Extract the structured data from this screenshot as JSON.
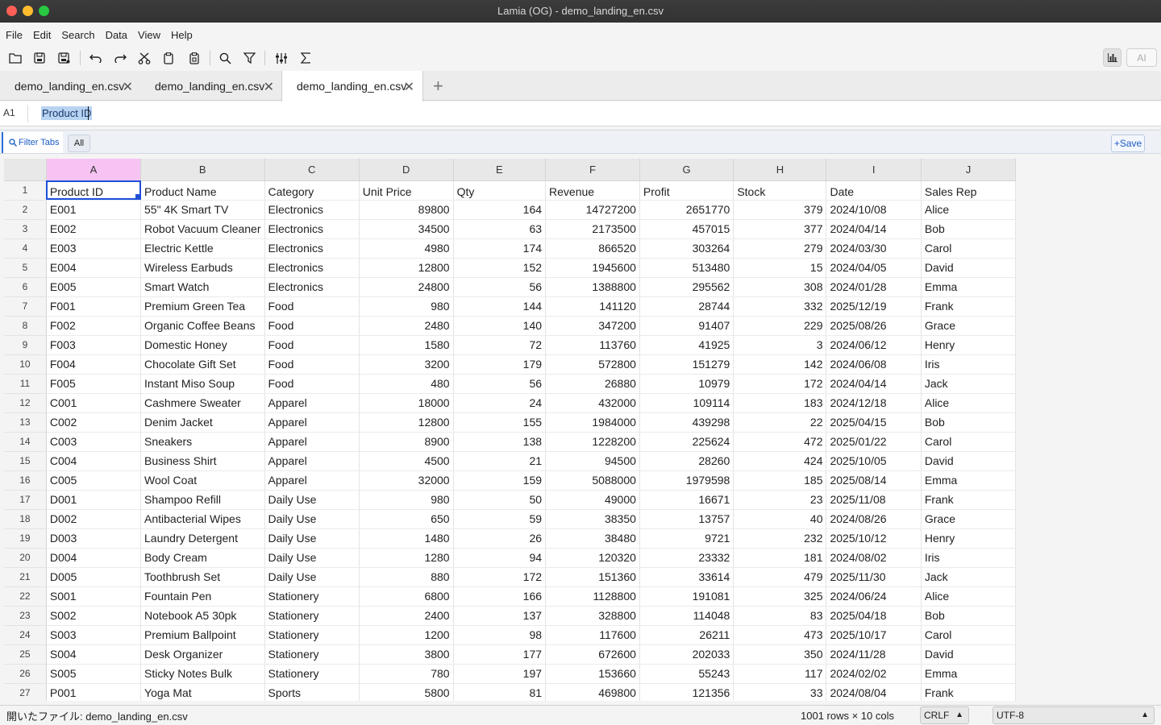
{
  "title": "Lamia (OG) - demo_landing_en.csv",
  "menu": [
    "File",
    "Edit",
    "Search",
    "Data",
    "View",
    "Help"
  ],
  "toolbar": {
    "ai_label": "AI"
  },
  "tabs": [
    {
      "label": "demo_landing_en.csv"
    },
    {
      "label": "demo_landing_en.csv"
    },
    {
      "label": "demo_landing_en.csv"
    }
  ],
  "formula": {
    "cell_ref": "A1",
    "value": "Product ID"
  },
  "filterbar": {
    "filter_label": "Filter Tabs",
    "all_label": "All",
    "save_label": "+Save"
  },
  "grid": {
    "columns": [
      "A",
      "B",
      "C",
      "D",
      "E",
      "F",
      "G",
      "H",
      "I",
      "J"
    ],
    "rows": [
      [
        "Product ID",
        "Product Name",
        "Category",
        "Unit Price",
        "Qty",
        "Revenue",
        "Profit",
        "Stock",
        "Date",
        "Sales Rep"
      ],
      [
        "E001",
        "55\" 4K Smart TV",
        "Electronics",
        "89800",
        "164",
        "14727200",
        "2651770",
        "379",
        "2024/10/08",
        "Alice"
      ],
      [
        "E002",
        "Robot Vacuum Cleaner",
        "Electronics",
        "34500",
        "63",
        "2173500",
        "457015",
        "377",
        "2024/04/14",
        "Bob"
      ],
      [
        "E003",
        "Electric Kettle",
        "Electronics",
        "4980",
        "174",
        "866520",
        "303264",
        "279",
        "2024/03/30",
        "Carol"
      ],
      [
        "E004",
        "Wireless Earbuds",
        "Electronics",
        "12800",
        "152",
        "1945600",
        "513480",
        "15",
        "2024/04/05",
        "David"
      ],
      [
        "E005",
        "Smart Watch",
        "Electronics",
        "24800",
        "56",
        "1388800",
        "295562",
        "308",
        "2024/01/28",
        "Emma"
      ],
      [
        "F001",
        "Premium Green Tea",
        "Food",
        "980",
        "144",
        "141120",
        "28744",
        "332",
        "2025/12/19",
        "Frank"
      ],
      [
        "F002",
        "Organic Coffee Beans",
        "Food",
        "2480",
        "140",
        "347200",
        "91407",
        "229",
        "2025/08/26",
        "Grace"
      ],
      [
        "F003",
        "Domestic Honey",
        "Food",
        "1580",
        "72",
        "113760",
        "41925",
        "3",
        "2024/06/12",
        "Henry"
      ],
      [
        "F004",
        "Chocolate Gift Set",
        "Food",
        "3200",
        "179",
        "572800",
        "151279",
        "142",
        "2024/06/08",
        "Iris"
      ],
      [
        "F005",
        "Instant Miso Soup",
        "Food",
        "480",
        "56",
        "26880",
        "10979",
        "172",
        "2024/04/14",
        "Jack"
      ],
      [
        "C001",
        "Cashmere Sweater",
        "Apparel",
        "18000",
        "24",
        "432000",
        "109114",
        "183",
        "2024/12/18",
        "Alice"
      ],
      [
        "C002",
        "Denim Jacket",
        "Apparel",
        "12800",
        "155",
        "1984000",
        "439298",
        "22",
        "2025/04/15",
        "Bob"
      ],
      [
        "C003",
        "Sneakers",
        "Apparel",
        "8900",
        "138",
        "1228200",
        "225624",
        "472",
        "2025/01/22",
        "Carol"
      ],
      [
        "C004",
        "Business Shirt",
        "Apparel",
        "4500",
        "21",
        "94500",
        "28260",
        "424",
        "2025/10/05",
        "David"
      ],
      [
        "C005",
        "Wool Coat",
        "Apparel",
        "32000",
        "159",
        "5088000",
        "1979598",
        "185",
        "2025/08/14",
        "Emma"
      ],
      [
        "D001",
        "Shampoo Refill",
        "Daily Use",
        "980",
        "50",
        "49000",
        "16671",
        "23",
        "2025/11/08",
        "Frank"
      ],
      [
        "D002",
        "Antibacterial Wipes",
        "Daily Use",
        "650",
        "59",
        "38350",
        "13757",
        "40",
        "2024/08/26",
        "Grace"
      ],
      [
        "D003",
        "Laundry Detergent",
        "Daily Use",
        "1480",
        "26",
        "38480",
        "9721",
        "232",
        "2025/10/12",
        "Henry"
      ],
      [
        "D004",
        "Body Cream",
        "Daily Use",
        "1280",
        "94",
        "120320",
        "23332",
        "181",
        "2024/08/02",
        "Iris"
      ],
      [
        "D005",
        "Toothbrush Set",
        "Daily Use",
        "880",
        "172",
        "151360",
        "33614",
        "479",
        "2025/11/30",
        "Jack"
      ],
      [
        "S001",
        "Fountain Pen",
        "Stationery",
        "6800",
        "166",
        "1128800",
        "191081",
        "325",
        "2024/06/24",
        "Alice"
      ],
      [
        "S002",
        "Notebook A5 30pk",
        "Stationery",
        "2400",
        "137",
        "328800",
        "114048",
        "83",
        "2025/04/18",
        "Bob"
      ],
      [
        "S003",
        "Premium Ballpoint",
        "Stationery",
        "1200",
        "98",
        "117600",
        "26211",
        "473",
        "2025/10/17",
        "Carol"
      ],
      [
        "S004",
        "Desk Organizer",
        "Stationery",
        "3800",
        "177",
        "672600",
        "202033",
        "350",
        "2024/11/28",
        "David"
      ],
      [
        "S005",
        "Sticky Notes Bulk",
        "Stationery",
        "780",
        "197",
        "153660",
        "55243",
        "117",
        "2024/02/02",
        "Emma"
      ],
      [
        "P001",
        "Yoga Mat",
        "Sports",
        "5800",
        "81",
        "469800",
        "121356",
        "33",
        "2024/08/04",
        "Frank"
      ]
    ]
  },
  "status": {
    "left": "開いたファイル: demo_landing_en.csv",
    "counts": "1001 rows × 10 cols",
    "line_ending": "CRLF",
    "encoding": "UTF-8"
  }
}
